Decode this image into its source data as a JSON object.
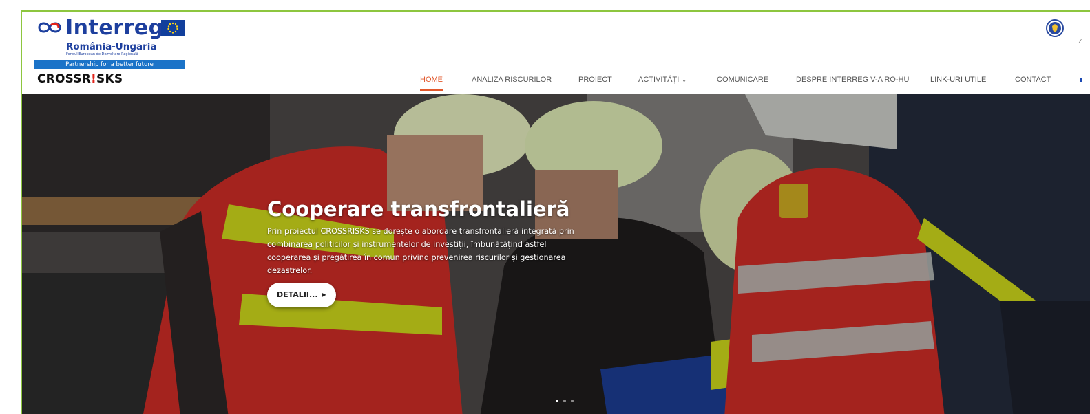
{
  "logo": {
    "wordmark": "Interreg",
    "region": "România-Ungaria",
    "fund": "Fondul European de Dezvoltare Regională",
    "tagline": "Partnership for a better future",
    "brand_main": "CROSSR",
    "brand_mark": "!",
    "brand_end": "SKS"
  },
  "nav": {
    "items": [
      {
        "label": "HOME",
        "active": true
      },
      {
        "label": "ANALIZA RISCURILOR"
      },
      {
        "label": "PROIECT"
      },
      {
        "label": "ACTIVITĂȚI",
        "dropdown": true
      },
      {
        "label": "COMUNICARE"
      },
      {
        "label": "DESPRE INTERREG V-A RO-HU"
      },
      {
        "label": "LINK-URI UTILE"
      },
      {
        "label": "CONTACT"
      }
    ],
    "dropdown_icon": "chevron-down-icon"
  },
  "hero": {
    "title": "Cooperare transfrontalieră",
    "text": "Prin proiectul CROSSRISKS se dorește o abordare transfrontalieră integrată prin combinarea politicilor și instrumentelor de investiții, îmbunătățind astfel cooperarea și pregătirea în comun privind prevenirea riscurilor și gestionarea dezastrelor.",
    "button_label": "DETALII...",
    "slides": 3,
    "active_slide": 1
  },
  "colors": {
    "accent": "#e2582c",
    "frame": "#8dc63f",
    "logo_blue": "#1d3f9e",
    "tagline_bg": "#1b73c8"
  }
}
